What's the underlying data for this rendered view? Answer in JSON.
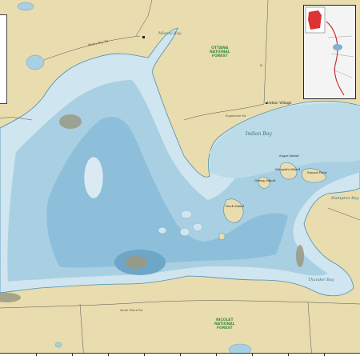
{
  "water_labels": {
    "misery_bay": "Misery Bay",
    "indian_bay": "Indian Bay",
    "thunder_bay": "Thunder Bay",
    "hampton_bay": "Hampton Bay"
  },
  "islands": {
    "duck_island": "Duck Island",
    "sugar_island": "Sugar Island",
    "grassy_island": "Grassy Island",
    "mosquito_island": "Mosquito Island",
    "sunset_point": "Sunset Point"
  },
  "forests": {
    "ottawa": "OTTAWA\nNATIONAL\nFOREST",
    "nicolet": "NICOLET\nNATIONAL\nFOREST"
  },
  "towns": {
    "indian_village": "Indian Village"
  },
  "roads": {
    "misery_bay_rd": "Misery Bay Rd",
    "sugarbush_rd": "Sugarbush Rd",
    "south_shore_rd": "South Shore Rd",
    "hwy_m": "M"
  },
  "colors": {
    "land": "#e9dcae",
    "water_shallow": "#cfe5ef",
    "water_mid": "#a9cfe2",
    "water_deep": "#7fb3d0",
    "shoal": "#9a9a82"
  }
}
